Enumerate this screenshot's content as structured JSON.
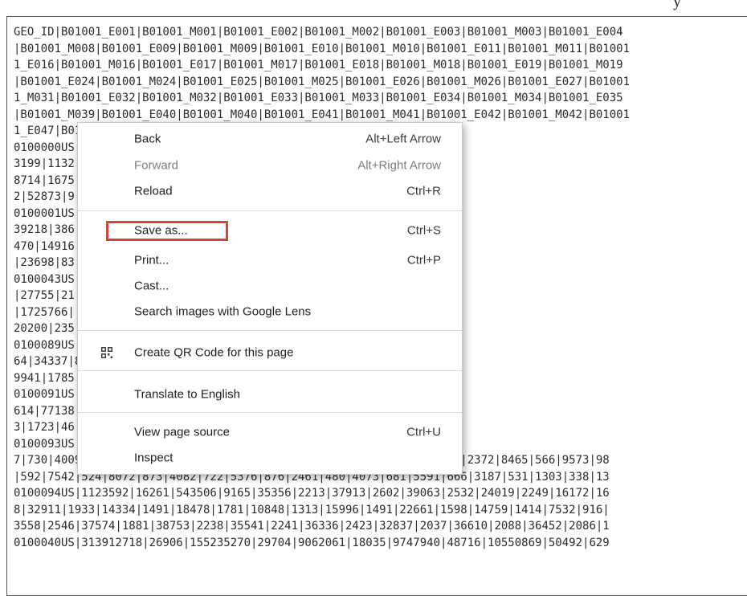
{
  "top_fragment": "y",
  "data_lines": [
    "GEO_ID|B01001_E001|B01001_M001|B01001_E002|B01001_M002|B01001_E003|B01001_M003|B01001_E004",
    "|B01001_M008|B01001_E009|B01001_M009|B01001_E010|B01001_M010|B01001_E011|B01001_M011|B01001",
    "1_E016|B01001_M016|B01001_E017|B01001_M017|B01001_E018|B01001_M018|B01001_E019|B01001_M019",
    "|B01001_E024|B01001_M024|B01001_E025|B01001_M025|B01001_E026|B01001_M026|B01001_E027|B01001",
    "1_M031|B01001_E032|B01001_M032|B01001_E033|B01001_M033|B01001_E034|B01001_M034|B01001_E035",
    "|B01001_M039|B01001_E040|B01001_M040|B01001_E041|B01001_M041|B01001_E042|B01001_M042|B01001",
    "1_E047|B01001_M047|B01001_E048|B01001_M048|B01001_E049|B01001_M049",
    "0100000US|321004407|0|159155|10284656|48771|11155383|509",
    "3199|1132|11312|1675|9155|17955|10438687|41263|4333806|3",
    "8714|1675|10084|50404|6313686|18709|4339246|21",
    "2|52873|9|42997|31645|6617129|38122|4080082|",
    "0100001US|321004407|987|8221994|46959|8883395|52445|52",
    "39218|386|38025203|39185|3287765|29830|4639878",
    "470|14916|30854|19563|3667382|22183|1836432",
    "|23698|83|64|33893|3141453|21326|4268604|256",
    "0100043US|3|2062662|24568|2271988|23707|1395",
    "|27755|21|34|21800|1046041|16346|1540076|181",
    "|1725766||45|671864|12027|329410|11387|29650",
    "20200|235|13624|1303194|16337|1873800|17800",
    "0100089US|687|38204|2950|27186|2291|17995|1",
    "64|34337|80|22287|1472|14094|1345|8971|972",
    "9941|1785|27928|1777|31117|2219|34963|1787|1",
    "0100091US|18|98025|3342|55345|1874|36018|21",
    "614|77138|2358|55234|2723|38182|1740|21397|1",
    "3|1723|46|0|2998|72816|1874|75763|1787|8125",
    "0100093US|341|993|6678|412|3503|562|1875|58",
    "7|730|4009|604|3841|646|5851|658|3112|491|1710|362|1016|432|130185|2372|8465|566|9573|98",
    "|592|7542|524|8072|873|4082|722|5376|876|2461|480|4073|681|5591|666|3187|531|1303|338|13",
    "0100094US|1123592|16261|543506|9165|35356|2213|37913|2602|39063|2532|24019|2249|16172|16",
    "8|32911|1933|14334|1491|18478|1781|10848|1313|15996|1491|22661|1598|14759|1414|7532|916|",
    "3558|2546|37574|1881|38753|2238|35541|2241|36336|2423|32837|2037|36610|2088|36452|2086|1",
    "0100040US|313912718|26906|155235270|29704|9062061|18035|9747940|48716|10550869|50492|629"
  ],
  "context_menu": {
    "back": {
      "label": "Back",
      "shortcut": "Alt+Left Arrow"
    },
    "forward": {
      "label": "Forward",
      "shortcut": "Alt+Right Arrow"
    },
    "reload": {
      "label": "Reload",
      "shortcut": "Ctrl+R"
    },
    "save_as": {
      "label": "Save as...",
      "shortcut": "Ctrl+S"
    },
    "print": {
      "label": "Print...",
      "shortcut": "Ctrl+P"
    },
    "cast": {
      "label": "Cast..."
    },
    "lens": {
      "label": "Search images with Google Lens"
    },
    "qr": {
      "label": "Create QR Code for this page",
      "icon": "qr-code-icon"
    },
    "translate": {
      "label": "Translate to English"
    },
    "view_source": {
      "label": "View page source",
      "shortcut": "Ctrl+U"
    },
    "inspect": {
      "label": "Inspect"
    }
  },
  "colors": {
    "highlight_border": "#d9443a",
    "text": "#2b2b2b",
    "disabled_text": "#7b7b7b"
  }
}
